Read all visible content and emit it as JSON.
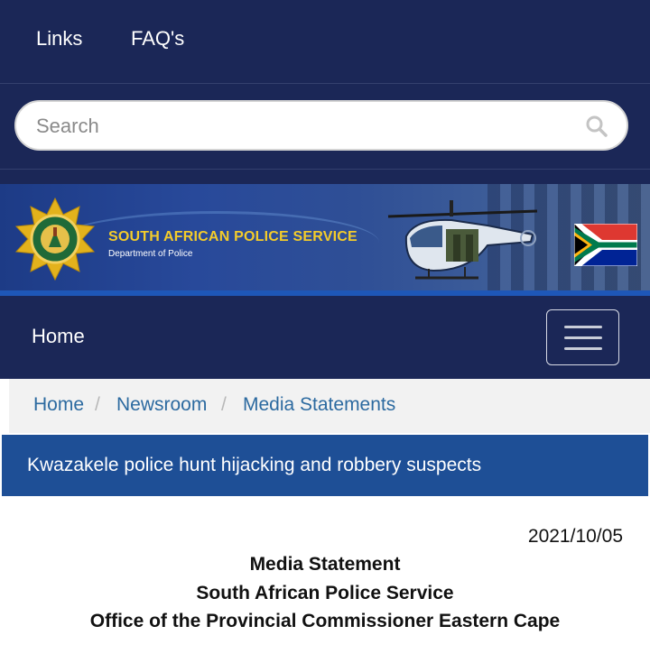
{
  "topnav": {
    "links_label": "Links",
    "faqs_label": "FAQ's"
  },
  "search": {
    "placeholder": "Search",
    "icon": "search-icon"
  },
  "banner": {
    "title": "SOUTH AFRICAN POLICE SERVICE",
    "subtitle": "Department of Police",
    "badge_icon": "saps-badge",
    "image": "police-helicopter",
    "flag": "south-african-flag"
  },
  "menubar": {
    "home_label": "Home",
    "menu_icon": "hamburger-menu-icon"
  },
  "breadcrumb": [
    "Home",
    "Newsroom",
    "Media Statements"
  ],
  "article": {
    "title": "Kwazakele police hunt hijacking and robbery suspects",
    "date": "2021/10/05",
    "heading_lines": [
      "Media Statement",
      "South African Police Service",
      "Office of the Provincial Commissioner Eastern Cape"
    ]
  },
  "colors": {
    "navy": "#1b2757",
    "title_bar": "#1e4f96",
    "link_blue": "#2c6aa0",
    "gold": "#f4cc2a"
  }
}
